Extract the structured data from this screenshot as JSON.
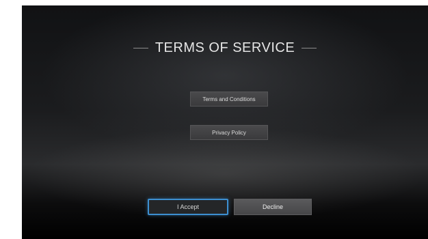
{
  "screen": {
    "title": "TERMS OF SERVICE",
    "menu": {
      "terms_label": "Terms and Conditions",
      "privacy_label": "Privacy Policy"
    },
    "actions": {
      "accept_label": "I Accept",
      "decline_label": "Decline"
    }
  },
  "colors": {
    "focus_accent": "#3d8fd1",
    "title_text": "#e6e6e6"
  }
}
